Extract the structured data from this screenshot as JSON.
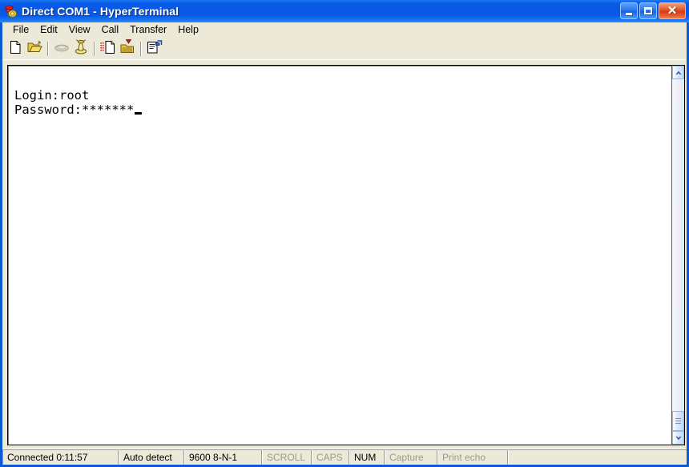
{
  "window": {
    "title": "Direct COM1 - HyperTerminal",
    "icon": "phone-handset-icon",
    "controls": {
      "minimize": "_",
      "maximize": "□",
      "close": "✕"
    }
  },
  "menubar": {
    "items": [
      {
        "label": "File",
        "name": "menu-file"
      },
      {
        "label": "Edit",
        "name": "menu-edit"
      },
      {
        "label": "View",
        "name": "menu-view"
      },
      {
        "label": "Call",
        "name": "menu-call"
      },
      {
        "label": "Transfer",
        "name": "menu-transfer"
      },
      {
        "label": "Help",
        "name": "menu-help"
      }
    ]
  },
  "toolbar": {
    "buttons": [
      {
        "icon": "new-connection-icon",
        "enabled": true
      },
      {
        "icon": "open-folder-icon",
        "enabled": true
      },
      {
        "icon": "call-phone-icon",
        "enabled": false
      },
      {
        "icon": "disconnect-phone-icon",
        "enabled": true
      },
      {
        "icon": "send-file-icon",
        "enabled": true
      },
      {
        "icon": "receive-file-icon",
        "enabled": true
      },
      {
        "icon": "properties-icon",
        "enabled": true
      }
    ]
  },
  "terminal": {
    "line1": "Login:root",
    "line2": "Password:*******",
    "cursor": "_"
  },
  "scrollbar": {
    "up_arrow": "▲",
    "down_arrow": "▼"
  },
  "statusbar": {
    "connected": "Connected 0:11:57",
    "detect": "Auto detect",
    "settings": "9600 8-N-1",
    "scroll": "SCROLL",
    "caps": "CAPS",
    "num": "NUM",
    "capture": "Capture",
    "print_echo": "Print echo"
  },
  "colors": {
    "title_blue": "#0a56e4",
    "client_beige": "#ece9d8",
    "terminal_bg": "#ffffff",
    "disabled_gray": "#9a9a8c",
    "close_red": "#d23b12"
  }
}
